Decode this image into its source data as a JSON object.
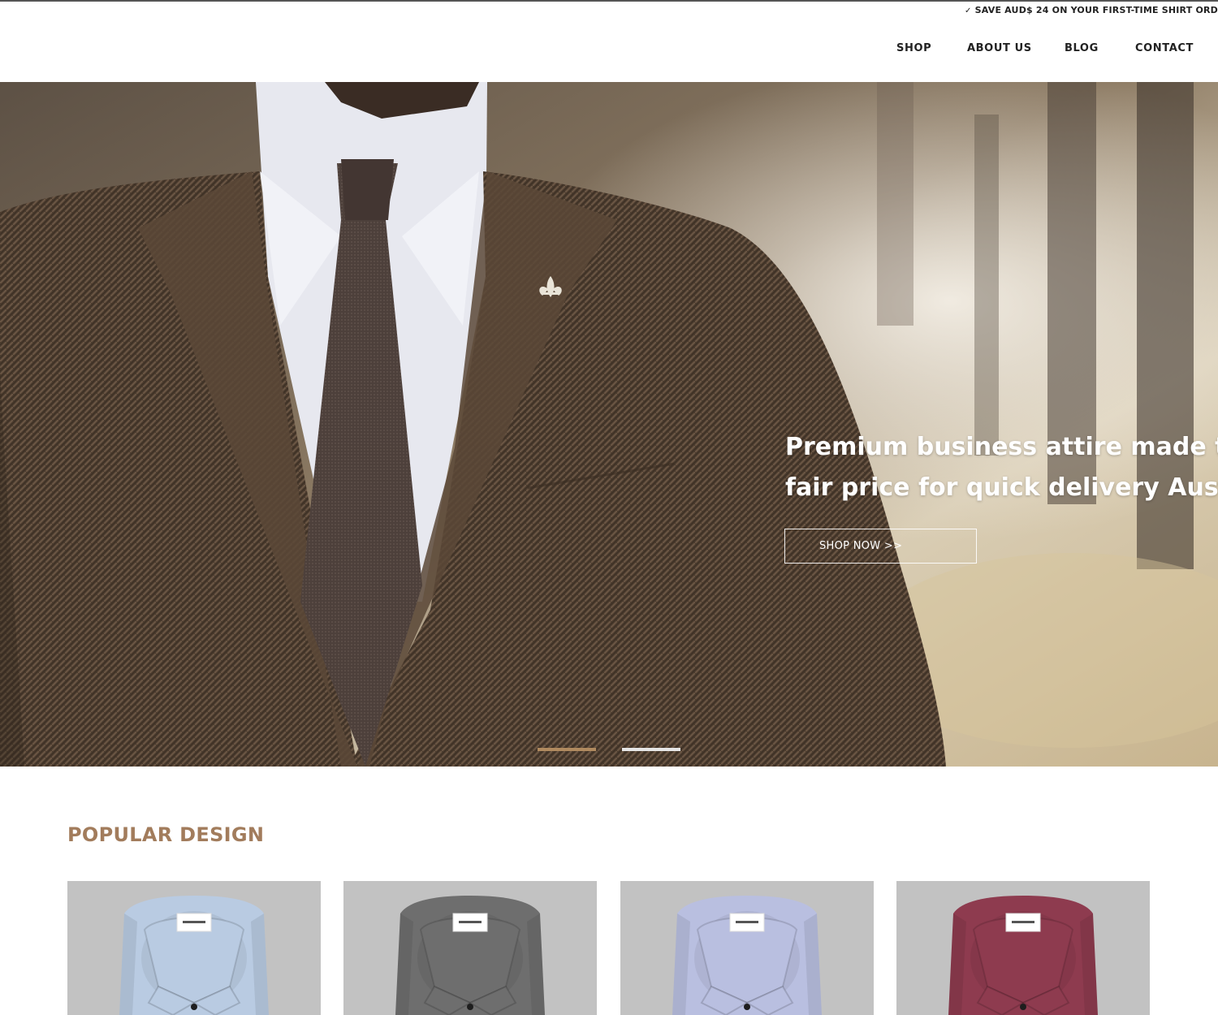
{
  "promo": {
    "text": "SAVE AUD$ 24 ON YOUR FIRST-TIME SHIRT ORD"
  },
  "nav": {
    "items": [
      {
        "label": "SHOP"
      },
      {
        "label": "ABOUT US"
      },
      {
        "label": "BLOG"
      },
      {
        "label": "CONTACT"
      }
    ]
  },
  "hero": {
    "line1": "Premium business attire made to me",
    "line2": "fair price for quick delivery Australia",
    "cta": "SHOP NOW >>",
    "slides_active": 1,
    "slides_total": 2
  },
  "popular": {
    "title": "POPULAR DESIGN",
    "products": [
      {
        "shirt_color": "#b9cbe2",
        "pattern": "fine check light blue"
      },
      {
        "shirt_color": "#6e6e6e",
        "pattern": "houndstooth grey"
      },
      {
        "shirt_color": "#b9bfe0",
        "pattern": "fine check lavender"
      },
      {
        "shirt_color": "#8e3b4f",
        "pattern": "check red-navy"
      }
    ]
  },
  "colors": {
    "accent": "#a27c5c",
    "active_dot": "#b08a5f"
  }
}
